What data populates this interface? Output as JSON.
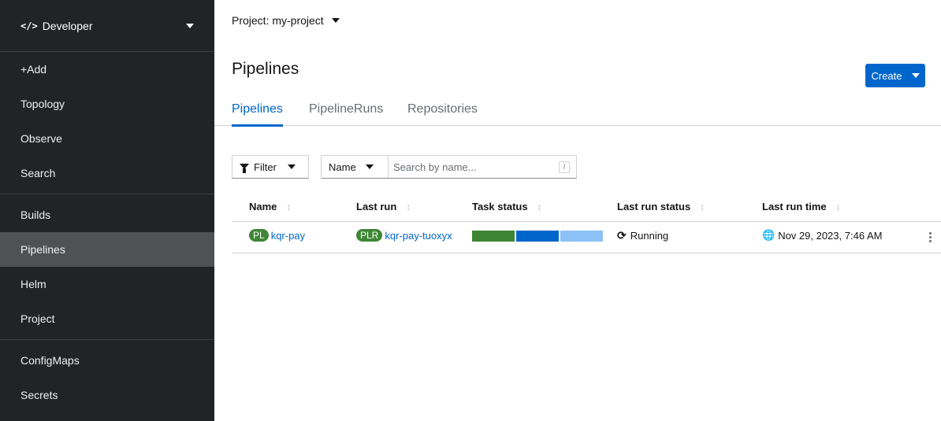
{
  "sidebar": {
    "perspective": {
      "icon": "code-icon",
      "label": "Developer"
    },
    "items": [
      {
        "label": "+Add"
      },
      {
        "label": "Topology"
      },
      {
        "label": "Observe"
      },
      {
        "label": "Search"
      },
      {
        "label": "Builds"
      },
      {
        "label": "Pipelines",
        "active": true
      },
      {
        "label": "Helm"
      },
      {
        "label": "Project"
      },
      {
        "label": "ConfigMaps"
      },
      {
        "label": "Secrets"
      }
    ]
  },
  "header": {
    "project_label": "Project: my-project",
    "title": "Pipelines",
    "create_label": "Create"
  },
  "tabs": [
    {
      "label": "Pipelines",
      "active": true
    },
    {
      "label": "PipelineRuns"
    },
    {
      "label": "Repositories"
    }
  ],
  "toolbar": {
    "filter_label": "Filter",
    "name_select": "Name",
    "search_placeholder": "Search by name...",
    "search_hint": "/"
  },
  "table": {
    "columns": [
      "Name",
      "Last run",
      "Task status",
      "Last run status",
      "Last run time"
    ],
    "rows": [
      {
        "name_badge": "PL",
        "name": "kqr-pay",
        "last_run_badge": "PLR",
        "last_run": "kqr-pay-tuoxyx",
        "task_status_colors": [
          "#3e8635",
          "#0066cc",
          "#8bc1f7"
        ],
        "last_run_status": "Running",
        "last_run_time": "Nov 29, 2023, 7:46 AM"
      }
    ]
  },
  "colors": {
    "accent": "#0066cc",
    "success": "#3e8635",
    "sidebar_bg": "#212427"
  }
}
